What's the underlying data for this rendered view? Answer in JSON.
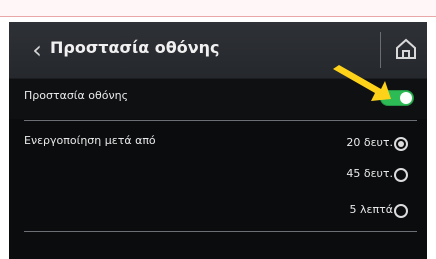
{
  "header": {
    "title": "Προστασία οθόνης"
  },
  "screen_protection": {
    "label": "Προστασία οθόνης",
    "enabled": true
  },
  "activation_after": {
    "label": "Ενεργοποίηση μετά από",
    "options": [
      {
        "label": "20 δευτ.",
        "selected": true
      },
      {
        "label": "45 δευτ.",
        "selected": false
      },
      {
        "label": "5 λεπτά",
        "selected": false
      }
    ]
  },
  "colors": {
    "header_bg": "#2e3136",
    "screen_bg": "#0b0c0e",
    "toggle_on": "#2dbb55",
    "arrow": "#ffd21a"
  },
  "icons": {
    "back": "back-chevron-icon",
    "home": "home-icon",
    "pointer": "yellow-arrow-icon"
  }
}
